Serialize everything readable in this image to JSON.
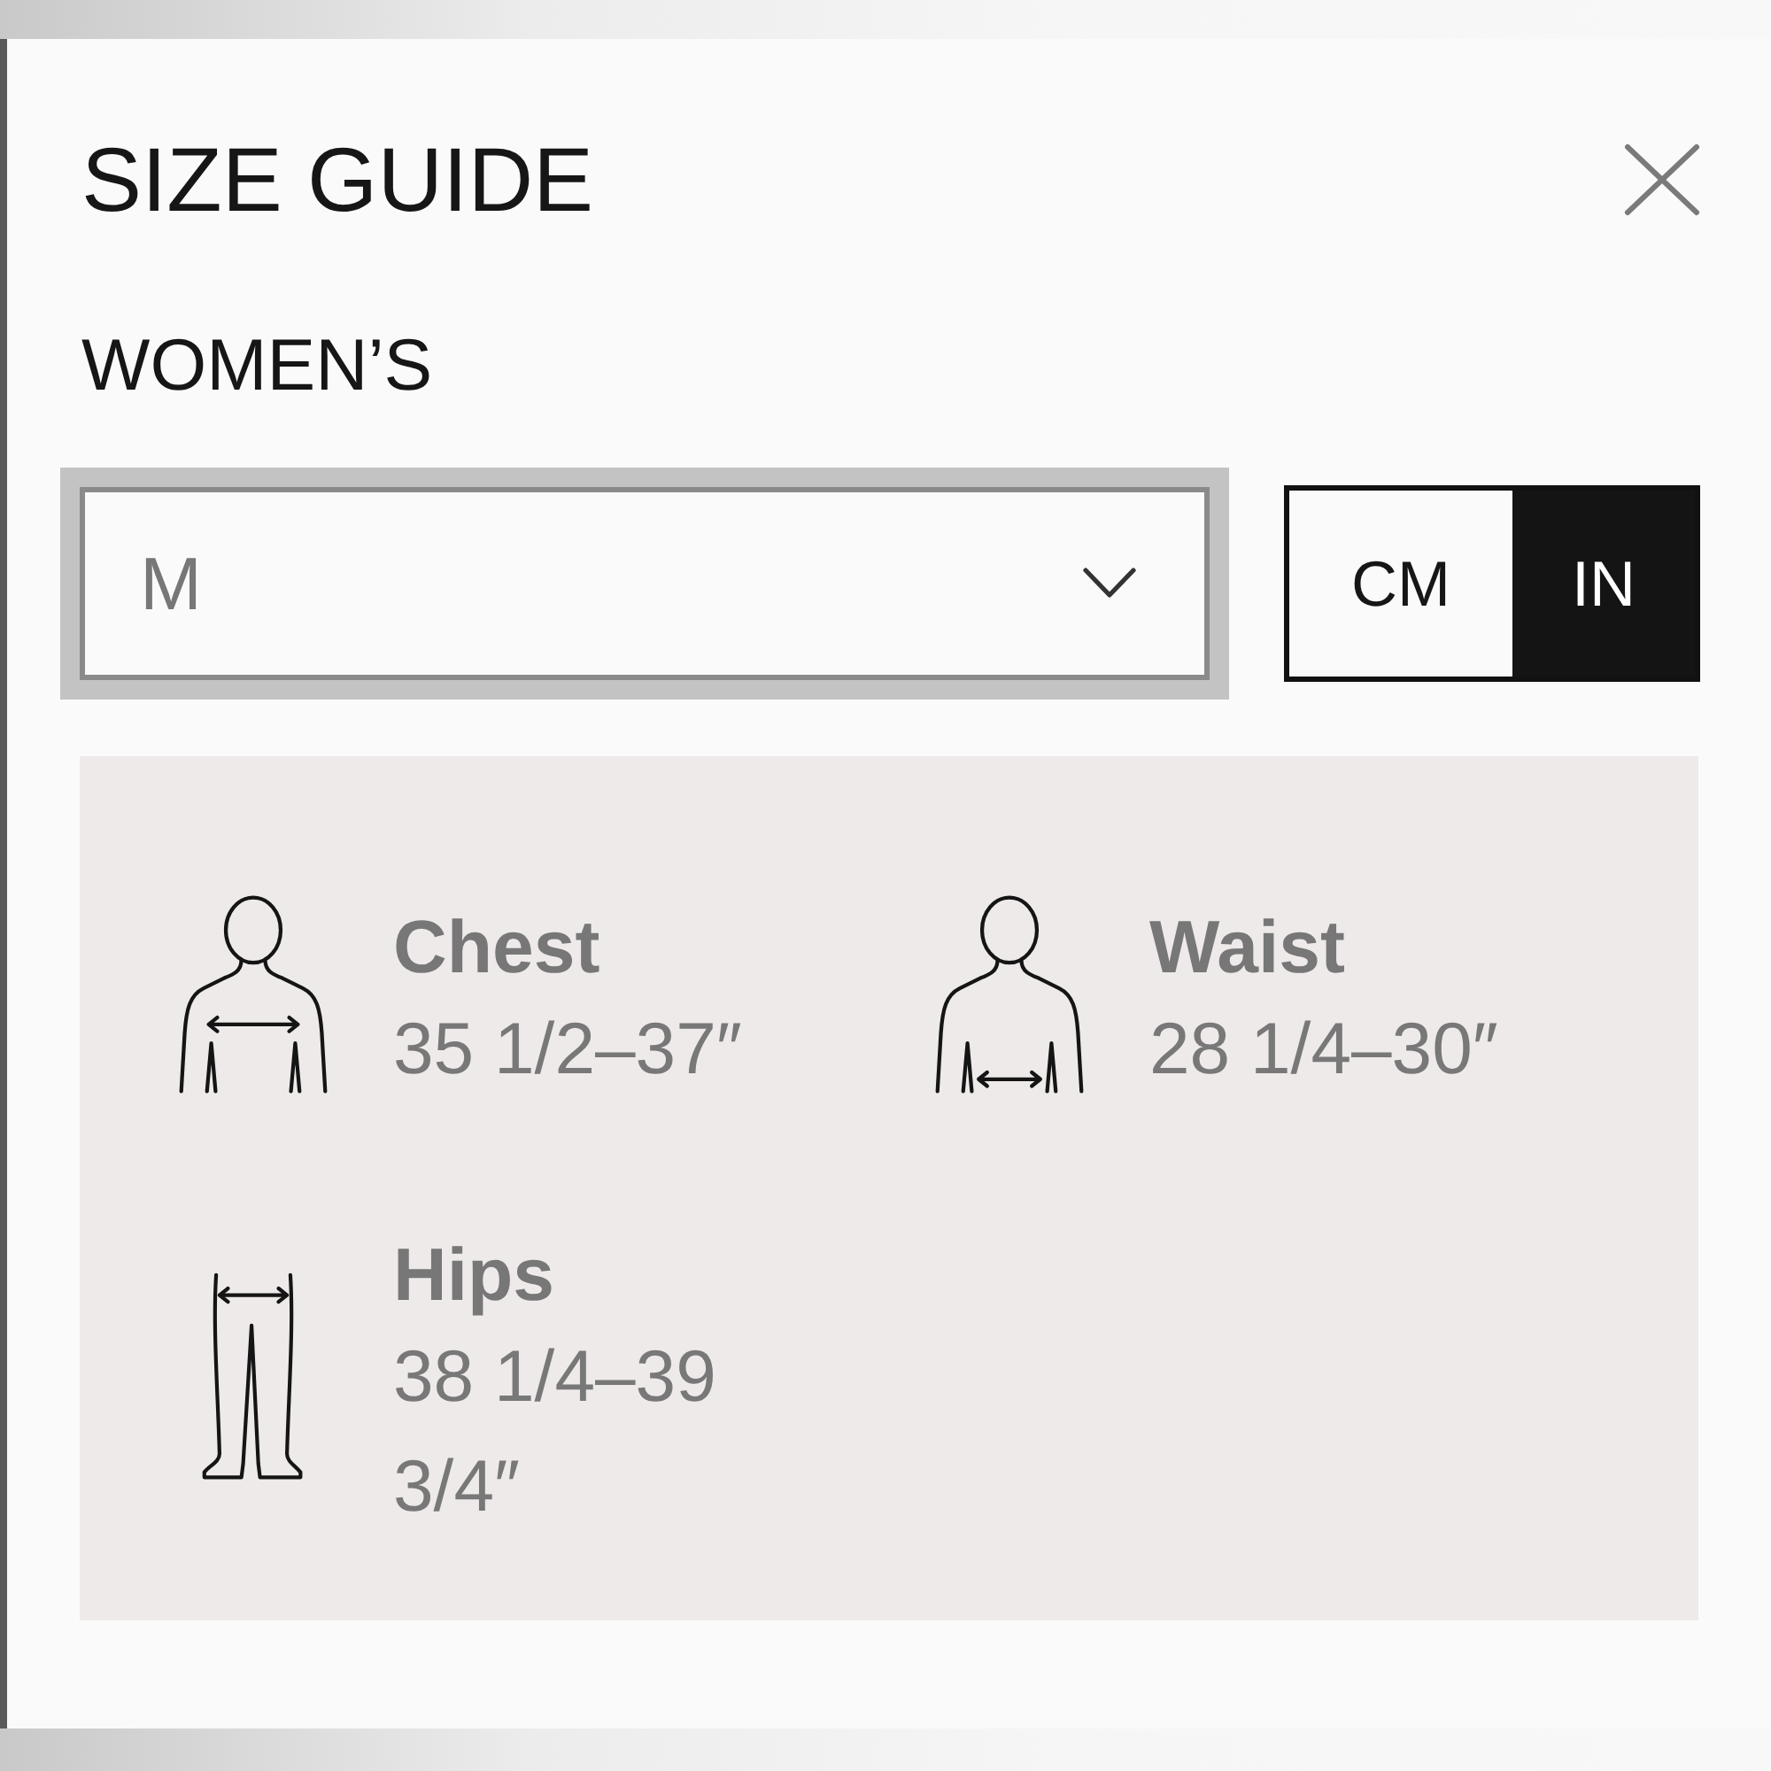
{
  "title": "SIZE GUIDE",
  "section": "WOMEN’S",
  "size_select": {
    "value": "M"
  },
  "unit_toggle": [
    {
      "label": "CM",
      "selected": false
    },
    {
      "label": "IN",
      "selected": true
    }
  ],
  "measurements": [
    {
      "kind": "chest",
      "label": "Chest",
      "value": "35 1/2–37″"
    },
    {
      "kind": "waist",
      "label": "Waist",
      "value": "28 1/4–30″"
    },
    {
      "kind": "hips",
      "label": "Hips",
      "value": "38 1/4–39 3/4″"
    }
  ]
}
